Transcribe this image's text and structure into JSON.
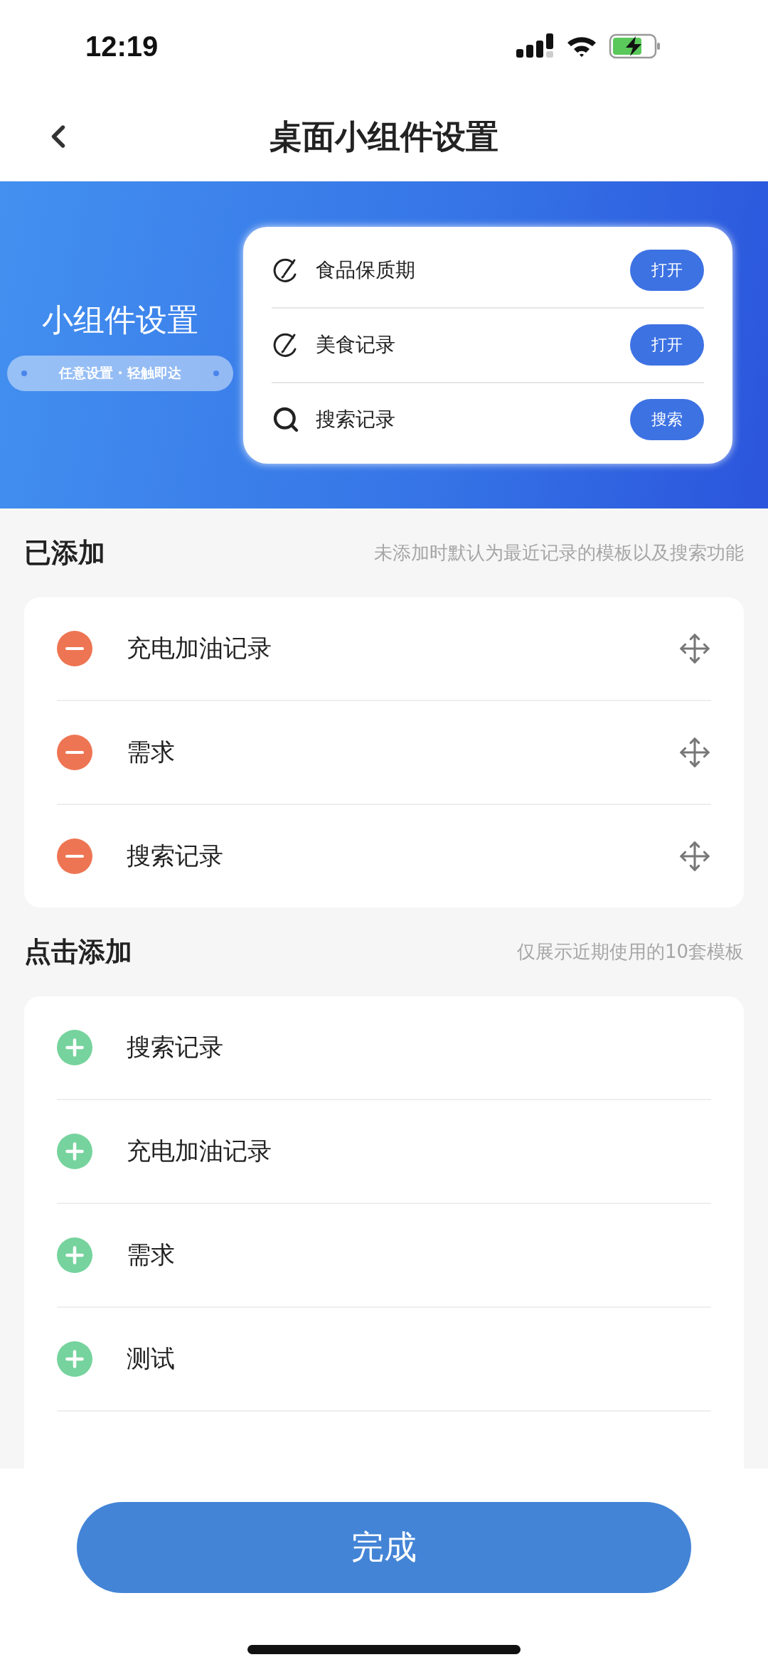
{
  "status_bar": {
    "time": "12:19"
  },
  "nav": {
    "title": "桌面小组件设置"
  },
  "banner": {
    "title": "小组件设置",
    "tagline": "任意设置 · 轻触即达",
    "widget_rows": [
      {
        "kind": "edit",
        "label": "食品保质期",
        "button": "打开"
      },
      {
        "kind": "edit",
        "label": "美食记录",
        "button": "打开"
      },
      {
        "kind": "search",
        "label": "搜索记录",
        "button": "搜索"
      }
    ]
  },
  "added": {
    "title": "已添加",
    "hint": "未添加时默认为最近记录的模板以及搜索功能",
    "items": [
      {
        "label": "充电加油记录"
      },
      {
        "label": "需求"
      },
      {
        "label": "搜索记录"
      }
    ]
  },
  "available": {
    "title": "点击添加",
    "hint": "仅展示近期使用的10套模板",
    "items": [
      {
        "label": "搜索记录"
      },
      {
        "label": "充电加油记录"
      },
      {
        "label": "需求"
      },
      {
        "label": "测试"
      }
    ]
  },
  "done_button": "完成"
}
